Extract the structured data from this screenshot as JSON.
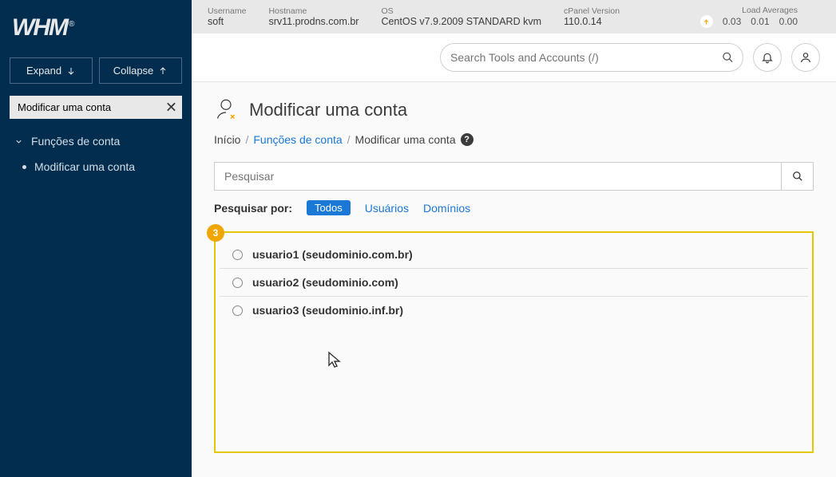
{
  "sidebar": {
    "logo": "WHM",
    "expand": "Expand",
    "collapse": "Collapse",
    "search_value": "Modificar uma conta",
    "nav_group": "Funções de conta",
    "nav_item": "Modificar uma conta"
  },
  "topbar": {
    "username_label": "Username",
    "username": "soft",
    "hostname_label": "Hostname",
    "hostname": "srv11.prodns.com.br",
    "os_label": "OS",
    "os": "CentOS v7.9.2009 STANDARD kvm",
    "cpanel_label": "cPanel Version",
    "cpanel": "110.0.14",
    "load_label": "Load Averages",
    "load1": "0.03",
    "load2": "0.01",
    "load3": "0.00"
  },
  "secondbar": {
    "search_placeholder": "Search Tools and Accounts (/)"
  },
  "page": {
    "title": "Modificar uma conta",
    "breadcrumb_home": "Início",
    "breadcrumb_group": "Funções de conta",
    "breadcrumb_current": "Modificar uma conta",
    "search_placeholder": "Pesquisar",
    "filter_label": "Pesquisar por:",
    "filter_all": "Todos",
    "filter_users": "Usuários",
    "filter_domains": "Domínios",
    "step_number": "3"
  },
  "accounts": {
    "row0": "usuario1 (seudominio.com.br)",
    "row1": "usuario2 (seudominio.com)",
    "row2": "usuario3 (seudominio.inf.br)"
  }
}
